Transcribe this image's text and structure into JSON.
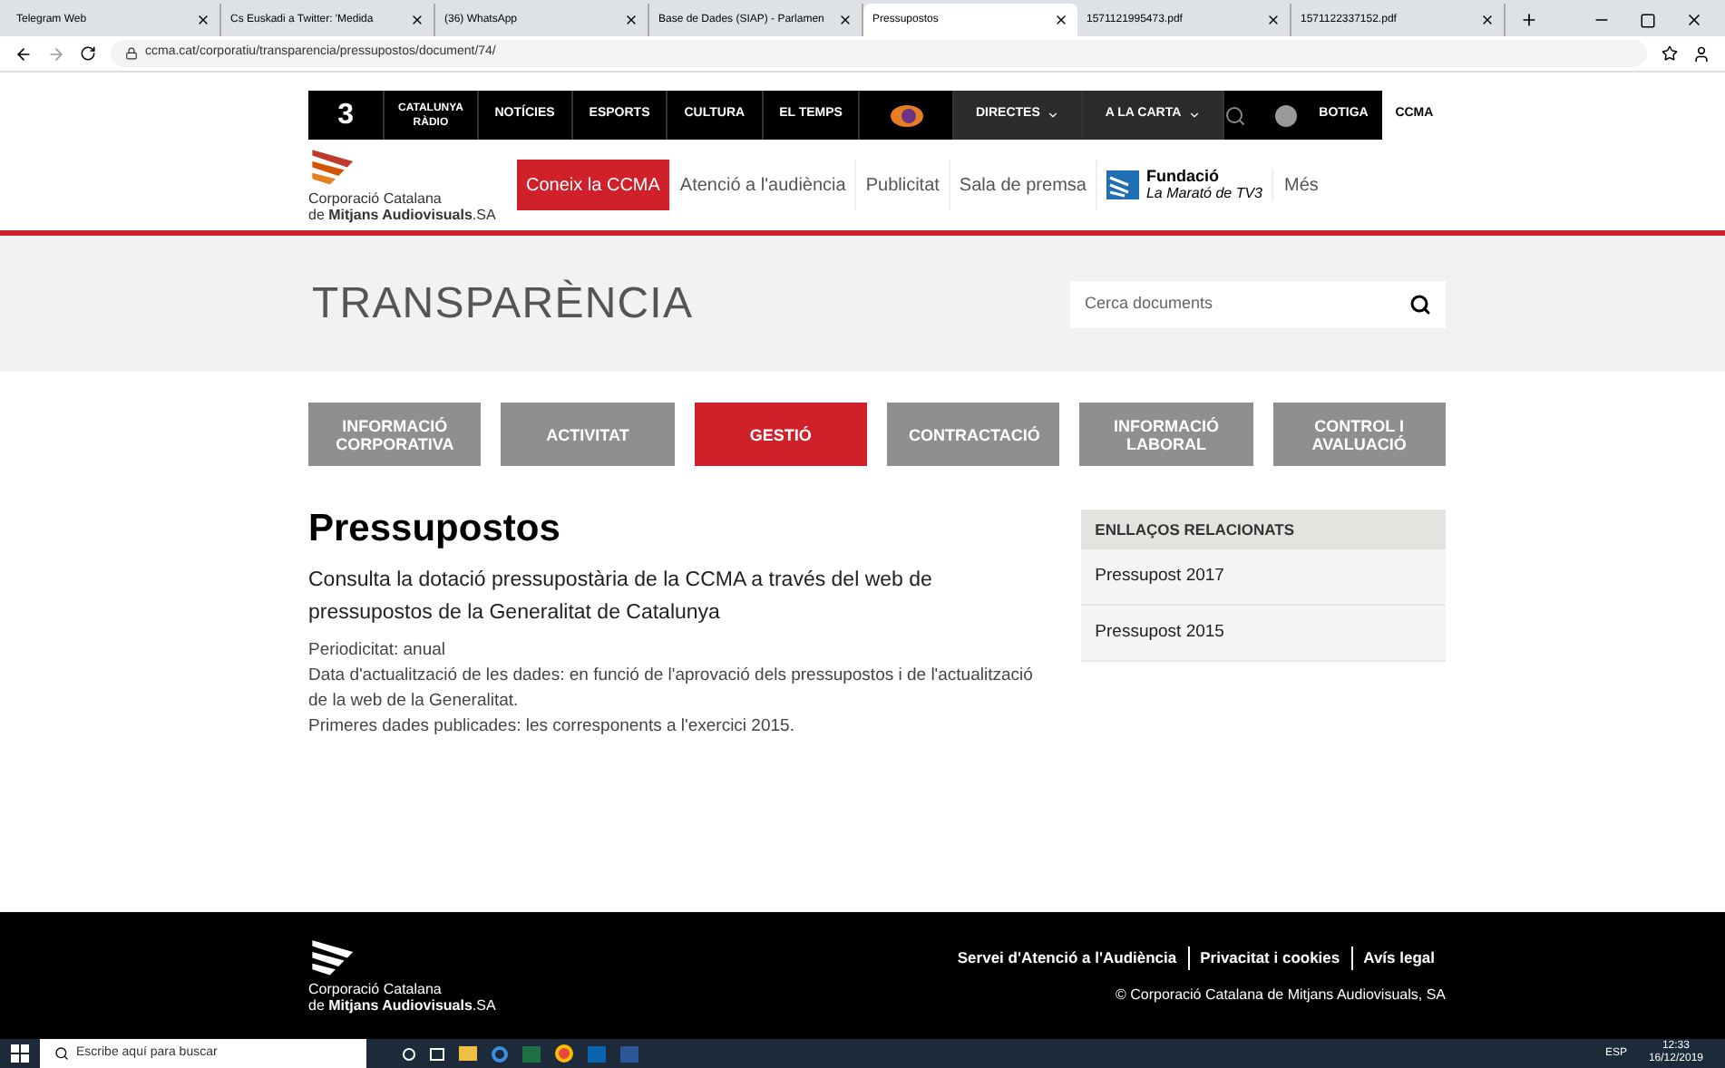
{
  "browser": {
    "tabs": [
      {
        "title": "Telegram Web",
        "selected": false
      },
      {
        "title": "Cs Euskadi a Twitter: 'Medida",
        "selected": false
      },
      {
        "title": "(36) WhatsApp",
        "selected": false
      },
      {
        "title": "Base de Dades (SIAP) - Parlamen",
        "selected": false
      },
      {
        "title": "Pressupostos",
        "selected": true
      },
      {
        "title": "1571121995473.pdf",
        "selected": false
      },
      {
        "title": "1571122337152.pdf",
        "selected": false
      }
    ],
    "url": "ccma.cat/corporatiu/transparencia/pressupostos/document/74/"
  },
  "top_nav": {
    "tv3_logo": "3",
    "radio_logo": [
      "CATALUNYA",
      "RÀDIO"
    ],
    "items": [
      {
        "label": "NOTÍCIES",
        "dropdown": false
      },
      {
        "label": "ESPORTS",
        "dropdown": false
      },
      {
        "label": "CULTURA",
        "dropdown": false
      },
      {
        "label": "EL TEMPS",
        "dropdown": false
      },
      {
        "label": "DIRECTES",
        "dropdown": true
      },
      {
        "label": "A LA CARTA",
        "dropdown": true
      }
    ],
    "shop": "BOTIGA",
    "corporate": {
      "label": "CCMA",
      "selected": true
    }
  },
  "corp_nav": {
    "logo": [
      "Corporació Catalana",
      "de **Mitjans Audiovisuals**.SA"
    ],
    "items": [
      {
        "label": "Coneix la CCMA",
        "selected": true
      },
      {
        "label": "Atenció a l'audiència",
        "selected": false
      },
      {
        "label": "Publicitat",
        "selected": false
      },
      {
        "label": "Sala de premsa",
        "selected": false
      }
    ],
    "foundation": [
      "Fundació",
      "La Marató de TV3"
    ],
    "more": "Més"
  },
  "banner": {
    "title": "TRANSPARÈNCIA",
    "search": {
      "placeholder": "Cerca documents"
    }
  },
  "sections": [
    {
      "label": "INFORMACIÓ CORPORATIVA",
      "selected": false
    },
    {
      "label": "ACTIVITAT",
      "selected": false
    },
    {
      "label": "GESTIÓ",
      "selected": true
    },
    {
      "label": "CONTRACTACIÓ",
      "selected": false
    },
    {
      "label": "INFORMACIÓ LABORAL",
      "selected": false
    },
    {
      "label": "CONTROL I AVALUACIÓ",
      "selected": false
    }
  ],
  "article": {
    "title": "Pressupostos",
    "lead": "Consulta la dotació pressupostària de la CCMA a través del web de pressupostos de la Generalitat de Catalunya",
    "lines": [
      "Periodicitat: anual",
      "Data d'actualització de les dades: en funció de l'aprovació dels pressupostos i de l'actualització de la web de la Generalitat.",
      "Primeres dades publicades: les corresponents a l'exercici 2015."
    ]
  },
  "related": {
    "title": "ENLLAÇOS RELACIONATS",
    "links": [
      "Pressupost 2017",
      "Pressupost 2015"
    ]
  },
  "footer": {
    "logo": [
      "Corporació Catalana",
      "de **Mitjans Audiovisuals**.SA"
    ],
    "links": [
      "Servei d'Atenció a l'Audiència",
      "Privacitat i cookies",
      "Avís legal"
    ],
    "copyright": "© Corporació Catalana de Mitjans Audiovisuals, SA"
  },
  "taskbar": {
    "search": {
      "placeholder": "Escribe aquí para buscar"
    },
    "language": "ESP",
    "time": "12:33",
    "date": "16/12/2019"
  }
}
